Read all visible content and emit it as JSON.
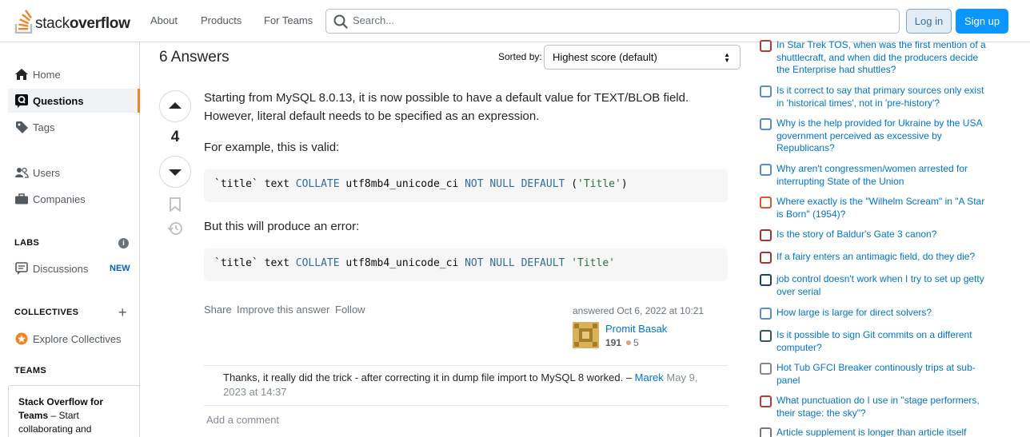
{
  "header": {
    "logo_light": "stack",
    "logo_bold": "overflow",
    "nav": [
      "About",
      "Products",
      "For Teams"
    ],
    "search_placeholder": "Search...",
    "login": "Log in",
    "signup": "Sign up",
    "brand_color": "#f48225",
    "primary_color": "#0a95ff"
  },
  "sidebar": {
    "nav": [
      {
        "label": "Home",
        "icon": "home-icon"
      },
      {
        "label": "Questions",
        "icon": "questions-icon",
        "active": true
      },
      {
        "label": "Tags",
        "icon": "tag-icon"
      },
      {
        "label": "Users",
        "icon": "users-icon"
      },
      {
        "label": "Companies",
        "icon": "briefcase-icon"
      }
    ],
    "labs_heading": "LABS",
    "discussions": "Discussions",
    "new_badge": "NEW",
    "collectives_heading": "COLLECTIVES",
    "explore_collectives": "Explore Collectives",
    "teams_heading": "TEAMS",
    "teams_title": "Stack Overflow for Teams",
    "teams_text": "– Start collaborating and"
  },
  "answers": {
    "count_label": "6 Answers",
    "sorted_by": "Sorted by:",
    "sort_value": "Highest score (default)"
  },
  "answer": {
    "score": "4",
    "paragraph1": "Starting from MySQL 8.0.13, it is now possible to have a default value for TEXT/BLOB field. However, literal default needs to be specified as an expression.",
    "paragraph2": "For example, this is valid:",
    "code1": {
      "col": "`title`",
      "type": "text",
      "collate": "COLLATE",
      "charset": "utf8mb4_unicode_ci",
      "not": "NOT",
      "null": "NULL",
      "default": "DEFAULT",
      "value": "(",
      "str": "'Title'",
      "close": ")"
    },
    "paragraph3": "But this will produce an error:",
    "code2": {
      "col": "`title`",
      "type": "text",
      "collate": "COLLATE",
      "charset": "utf8mb4_unicode_ci",
      "not": "NOT",
      "null": "NULL",
      "default": "DEFAULT",
      "str": "'Title'"
    },
    "menu": [
      "Share",
      "Improve this answer",
      "Follow"
    ],
    "answered": "answered Oct 6, 2022 at 10:21",
    "user": "Promit Basak",
    "reputation": "191",
    "bronze_badges": "5"
  },
  "comment": {
    "text": "Thanks, it really did the trick - after correcting it in dump file import to MySQL 8 worked. –",
    "author": "Marek",
    "date": "May 9, 2023 at 14:37",
    "add": "Add a comment"
  },
  "hot_questions": [
    {
      "title": "In Star Trek TOS, when was the first mention of a shuttlecraft, and when did the producers decide the Enterprise had shuttles?",
      "icon": "scifi-site-icon",
      "color": "#b73a3a"
    },
    {
      "title": "Is it correct to say that primary sources only exist in 'historical times', not in 'pre-history'?",
      "icon": "history-site-icon",
      "color": "#5b8bd0"
    },
    {
      "title": "Why is the help provided for Ukraine by the USA government perceived as excessive by Republicans?",
      "icon": "politics-site-icon",
      "color": "#5b8bd0"
    },
    {
      "title": "Why aren't congressmen/women arrested for interrupting State of the Union",
      "icon": "law-site-icon",
      "color": "#5b8bd0"
    },
    {
      "title": "Where exactly is the \"Wilhelm Scream\" in \"A Star is Born\" (1954)?",
      "icon": "movies-site-icon",
      "color": "#d9572b"
    },
    {
      "title": "Is the story of Baldur's Gate 3 canon?",
      "icon": "rpg-site-icon",
      "color": "#a83232"
    },
    {
      "title": "If a fairy enters an antimagic field, do they die?",
      "icon": "rpg-site-icon",
      "color": "#a83232"
    },
    {
      "title": "job control doesn't work when I try to set up getty over serial",
      "icon": "unix-site-icon",
      "color": "#1c3f6e"
    },
    {
      "title": "How large is large for direct solvers?",
      "icon": "scicomp-site-icon",
      "color": "#5b8bd0"
    },
    {
      "title": "Is it possible to sign Git commits on a different computer?",
      "icon": "security-site-icon",
      "color": "#2f5a5a"
    },
    {
      "title": "Hot Tub GFCI Breaker continously trips at sub-panel",
      "icon": "diy-site-icon",
      "color": "#888888"
    },
    {
      "title": "What punctuation do I use in \"stage performers, their stage: the sky\"?",
      "icon": "english-site-icon",
      "color": "#b83b3b"
    },
    {
      "title": "Article supplement is longer than article itself",
      "icon": "academia-site-icon",
      "color": "#777777"
    }
  ]
}
